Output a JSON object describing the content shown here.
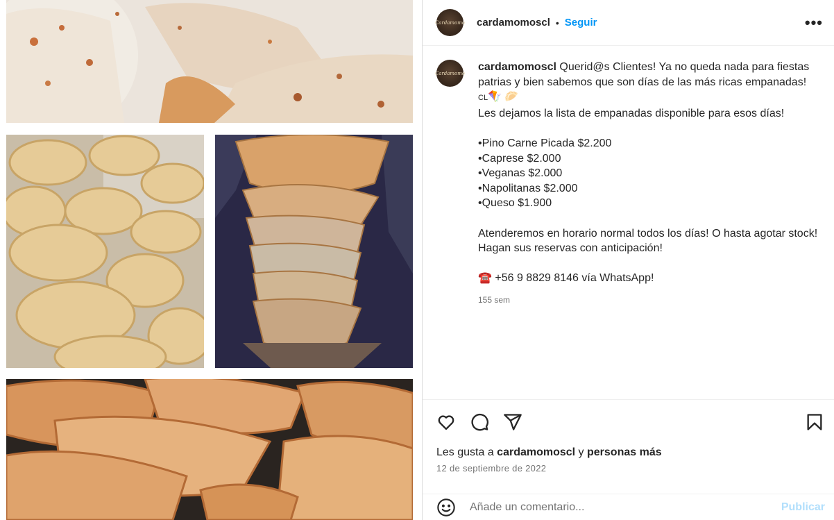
{
  "post": {
    "username": "cardamomoscl",
    "follow_label": "Seguir",
    "avatar_text": "Cardamomo",
    "separator": "•",
    "more_label": "•••"
  },
  "caption": {
    "username": "cardamomoscl",
    "text_1": " Querid@s Clientes! Ya no queda nada para fiestas patrias y bien sabemos que son días de las más ricas empanadas!",
    "flag": "CL",
    "emojis": "🪁 🥟",
    "text_2": "Les dejamos la lista de empanadas disponible para esos días!",
    "items": [
      "•Pino Carne Picada $2.200",
      "•Caprese $2.000",
      "•Veganas $2.000",
      "•Napolitanas $2.000",
      "•Queso $1.900"
    ],
    "text_3": "Atenderemos en horario normal todos los días! O hasta agotar stock!",
    "text_4": "Hagan sus reservas con anticipación!",
    "phone_icon": "☎️",
    "phone_text": " +56 9 8829 8146 vía WhatsApp!",
    "time": "155 sem"
  },
  "actions": {
    "likes_prefix": "Les gusta a ",
    "likes_user": "cardamomoscl",
    "likes_mid": " y ",
    "likes_others": "personas más",
    "date": "12 de septiembre de 2022"
  },
  "comment": {
    "placeholder": "Añade un comentario...",
    "publish_label": "Publicar"
  },
  "icons": {
    "like": "heart-icon",
    "comment": "comment-bubble-icon",
    "share": "paper-plane-icon",
    "save": "bookmark-icon",
    "emoji": "smiley-icon",
    "more": "more-dots-icon"
  }
}
